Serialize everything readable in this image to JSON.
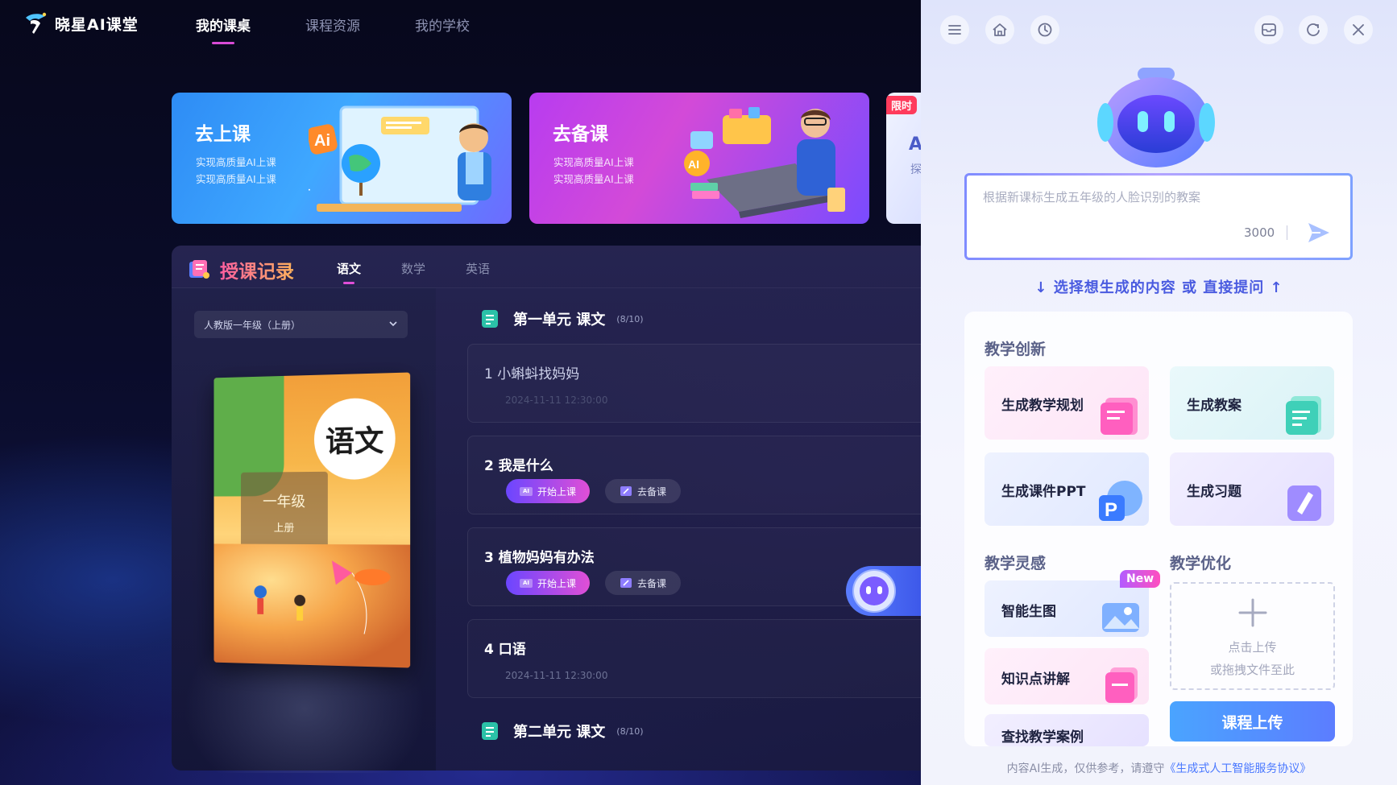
{
  "app": {
    "logo_text": "晓星AI课堂",
    "nav": [
      "我的课桌",
      "课程资源",
      "我的学校"
    ]
  },
  "cards": {
    "go_class": {
      "title": "去上课",
      "sub1": "实现高质量AI上课",
      "sub2": "实现高质量AI上课",
      "ai_badge": "Ai"
    },
    "prep_class": {
      "title": "去备课",
      "sub1": "实现高质量AI上课",
      "sub2": "实现高质量AI上课",
      "ai_badge": "AI"
    },
    "limited": {
      "badge": "限时",
      "letter": "A",
      "letter2": "探"
    }
  },
  "records": {
    "title": "授课记录",
    "tabs": [
      "语文",
      "数学",
      "英语"
    ],
    "grade_select": "人教版一年级（上册）",
    "book": {
      "title": "语文",
      "grade": "一年级",
      "volume": "上册"
    },
    "units": [
      {
        "title": "第一单元 课文",
        "count": "(8/10)"
      },
      {
        "title": "第二单元 课文",
        "count": "(8/10)"
      }
    ],
    "lessons": [
      {
        "title": "1 小蝌蚪找妈妈",
        "time": "2024-11-11 12:30:00"
      },
      {
        "title": "2 我是什么"
      },
      {
        "title": "3 植物妈妈有办法"
      },
      {
        "title": "4 口语",
        "time": "2024-11-11 12:30:00"
      }
    ],
    "start_label": "开始上课",
    "prep_label": "去备课",
    "ai_tag": "AI"
  },
  "panel": {
    "prompt_placeholder": "根据新课标生成五年级的人脸识别的教案",
    "prompt_count": "3000",
    "hint": "↓ 选择想生成的内容 或 直接提问 ↑",
    "sections": {
      "innovation": "教学创新",
      "inspiration": "教学灵感",
      "optimize": "教学优化"
    },
    "tools": {
      "plan": "生成教学规划",
      "lesson_plan": "生成教案",
      "ppt": "生成课件PPT",
      "exercise": "生成习题",
      "image": "智能生图",
      "knowledge": "知识点讲解",
      "case": "查找教学案例"
    },
    "new_badge": "New",
    "ppt_glyph": "P",
    "upload": {
      "line1": "点击上传",
      "line2": "或拖拽文件至此",
      "button": "课程上传"
    },
    "footer_text": "内容AI生成，仅供参考，请遵守",
    "footer_link": "《生成式人工智能服务协议》"
  },
  "colors": {
    "accent_pink": "#e04ed8",
    "accent_blue": "#4a5be0",
    "card_blue": "#3fa8ff",
    "card_purple": "#d34ad8"
  }
}
